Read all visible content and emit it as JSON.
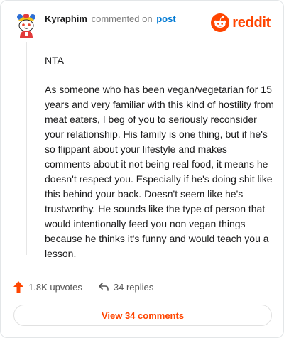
{
  "header": {
    "username": "Kyraphim",
    "action_text": "commented on",
    "post_link": "post",
    "logo_text": "reddit"
  },
  "comment": {
    "paragraphs": [
      "NTA",
      "As someone who has been vegan/vegetarian for 15 years and very familiar with this kind of hostility from meat eaters, I beg of you to seriously reconsider your relationship. His family is one thing, but if he's so flippant about your lifestyle and makes comments about it not being real food, it means he doesn't respect you. Especially if he's doing shit like this behind your back. Doesn't seem like he's trustworthy. He sounds like the type of person that would intentionally feed you non vegan things because he thinks it's funny and would teach you a lesson."
    ]
  },
  "actions": {
    "upvotes": "1.8K upvotes",
    "replies": "34 replies"
  },
  "footer": {
    "view_comments_label": "View 34 comments"
  },
  "colors": {
    "brand": "#ff4500",
    "link": "#0079d3",
    "text": "#1a1a1b",
    "muted": "#7c7c7c"
  },
  "icons": {
    "avatar": "snoo-avatar",
    "logo": "reddit-snoo-icon",
    "upvote": "upvote-arrow-icon",
    "reply": "reply-arrow-icon"
  }
}
